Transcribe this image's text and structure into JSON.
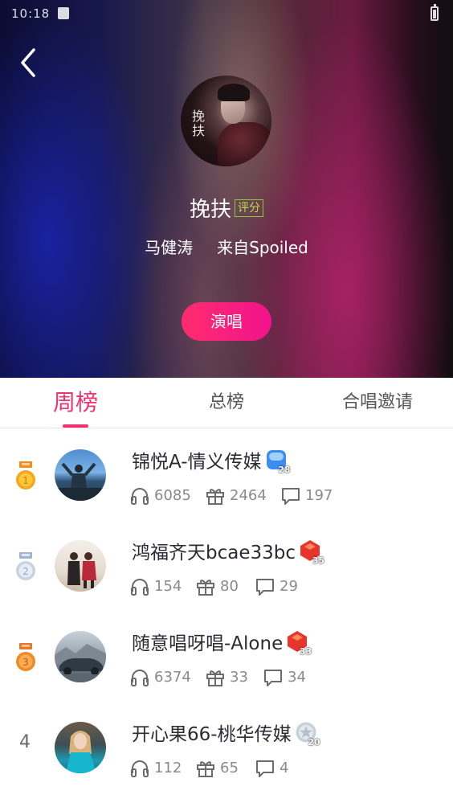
{
  "status_bar": {
    "time": "10:18"
  },
  "hero": {
    "cover_text": "挽扶",
    "song_title": "挽扶",
    "rating_badge": "评分",
    "artist": "马健涛",
    "source": "来自Spoiled",
    "sing_button": "演唱"
  },
  "tabs": [
    {
      "label": "周榜",
      "active": true
    },
    {
      "label": "总榜",
      "active": false
    },
    {
      "label": "合唱邀请",
      "active": false
    }
  ],
  "colors": {
    "accent": "#f0336e",
    "sing_gradient": [
      "#ff2d6e",
      "#f0138c"
    ],
    "gold": "#f5a623",
    "silver": "#c9d3e0",
    "bronze": "#f08a24"
  },
  "rank_list": [
    {
      "rank": "1",
      "medal": "gold-medal-icon",
      "name": "锦悦A-情义传媒",
      "level_icon": "blue-gem-icon",
      "level": "28",
      "listens": "6085",
      "gifts": "2464",
      "comments": "197"
    },
    {
      "rank": "2",
      "medal": "silver-medal-icon",
      "name": "鸿福齐天bcae33bc",
      "level_icon": "red-gem-icon",
      "level": "35",
      "listens": "154",
      "gifts": "80",
      "comments": "29"
    },
    {
      "rank": "3",
      "medal": "bronze-medal-icon",
      "name": "随意唱呀唱-Alone",
      "level_icon": "red-gem-icon",
      "level": "33",
      "listens": "6374",
      "gifts": "33",
      "comments": "34"
    },
    {
      "rank": "4",
      "medal": "",
      "name": "开心果66-桃华传媒",
      "level_icon": "silver-star-icon",
      "level": "20",
      "listens": "112",
      "gifts": "65",
      "comments": "4"
    }
  ]
}
